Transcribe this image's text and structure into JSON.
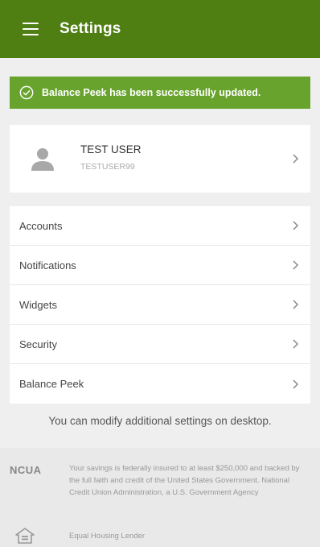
{
  "header": {
    "title": "Settings",
    "menu_icon": "hamburger-menu-icon",
    "background_color": "#4f7f12"
  },
  "banner": {
    "message": "Balance Peek has been successfully updated.",
    "icon": "check-circle-icon",
    "background_color": "#68a42d"
  },
  "user": {
    "name": "TEST USER",
    "username": "TESTUSER99",
    "avatar_icon": "person-icon"
  },
  "menu": {
    "items": [
      {
        "label": "Accounts"
      },
      {
        "label": "Notifications"
      },
      {
        "label": "Widgets"
      },
      {
        "label": "Security"
      },
      {
        "label": "Balance Peek"
      }
    ]
  },
  "note": {
    "text": "You can modify additional settings on desktop."
  },
  "footer": {
    "ncua_label": "NCUA",
    "ncua_text": "Your savings is federally insured to at least $250,000 and backed by the full faith and credit of the United States Government. National Credit Union Administration, a U.S. Government Agency",
    "equal_housing_text": "Equal Housing Lender",
    "equal_housing_icon": "equal-housing-icon"
  }
}
